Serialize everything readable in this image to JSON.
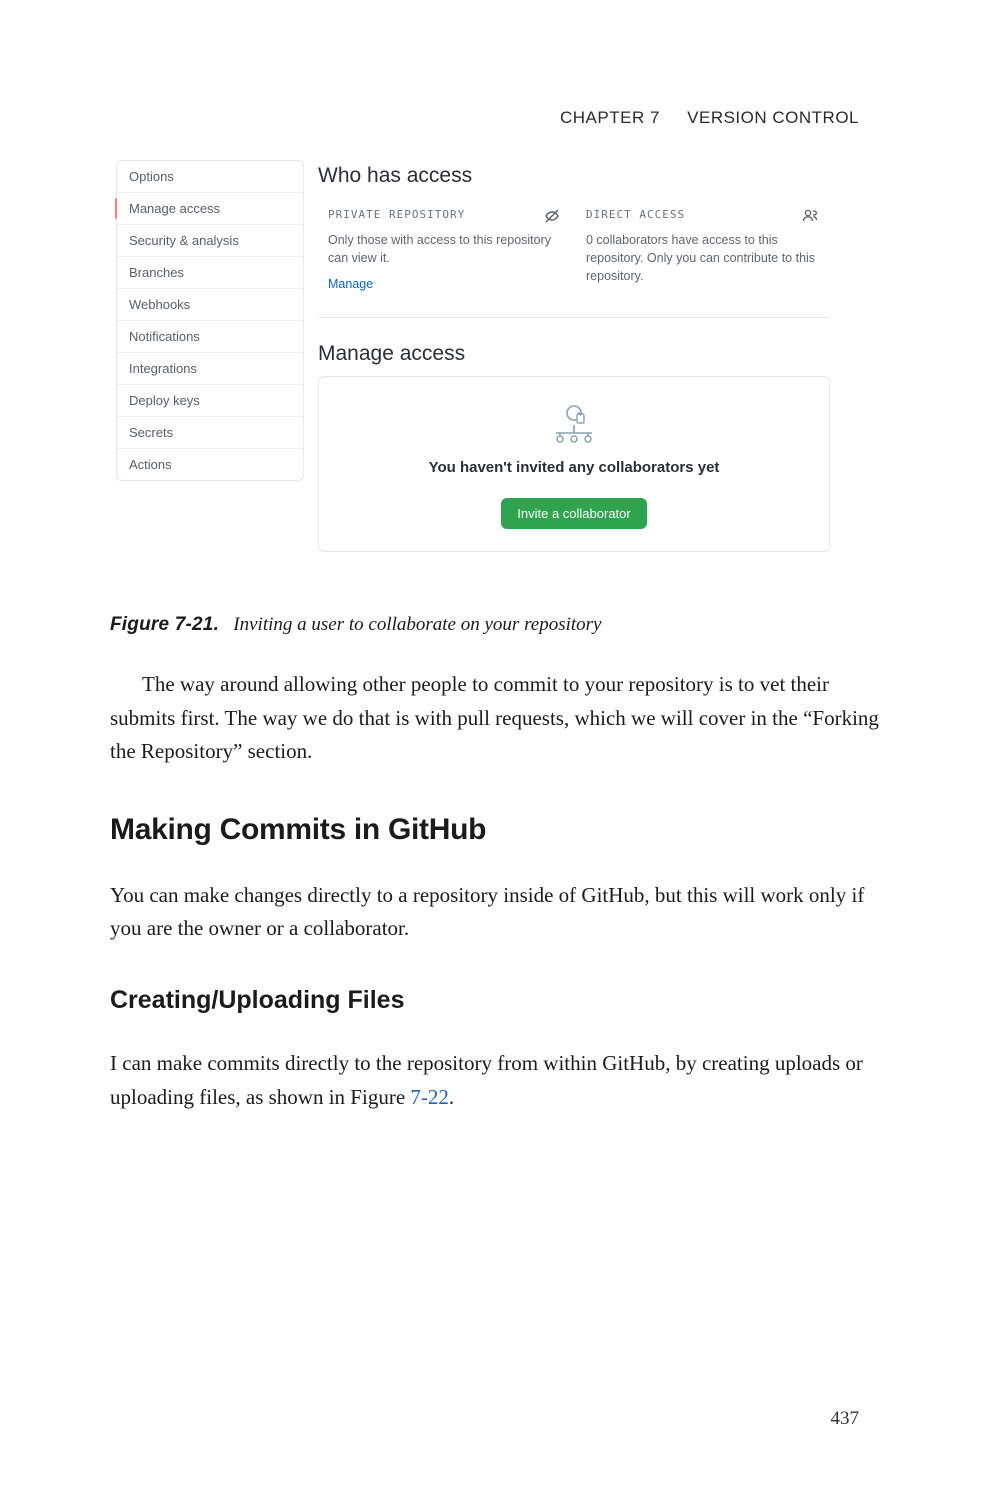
{
  "running_head": {
    "chapter": "CHAPTER 7",
    "title": "VERSION CONTROL"
  },
  "screenshot": {
    "sidebar": {
      "items": [
        "Options",
        "Manage access",
        "Security & analysis",
        "Branches",
        "Webhooks",
        "Notifications",
        "Integrations",
        "Deploy keys",
        "Secrets",
        "Actions"
      ],
      "selected_index": 1
    },
    "section1_title": "Who has access",
    "card_private": {
      "label": "PRIVATE REPOSITORY",
      "desc": "Only those with access to this repository can view it.",
      "link": "Manage"
    },
    "card_direct": {
      "label": "DIRECT ACCESS",
      "desc": "0 collaborators have access to this repository. Only you can contribute to this repository."
    },
    "section2_title": "Manage access",
    "empty_message": "You haven't invited any collaborators yet",
    "invite_button": "Invite a collaborator"
  },
  "figure": {
    "label": "Figure 7-21.",
    "caption": "Inviting a user to collaborate on your repository"
  },
  "para1": "The way around allowing other people to commit to your repository is to vet their submits first. The way we do that is with pull requests, which we will cover in the “Forking the Repository” section.",
  "h2": "Making Commits in GitHub",
  "para2": "You can make changes directly to a repository inside of GitHub, but this will work only if you are the owner or a collaborator.",
  "h3": "Creating/Uploading Files",
  "para3_a": "I can make commits directly to the repository from within GitHub, by creating uploads or uploading files, as shown in Figure ",
  "para3_ref": "7-22",
  "para3_b": ".",
  "page_number": "437"
}
